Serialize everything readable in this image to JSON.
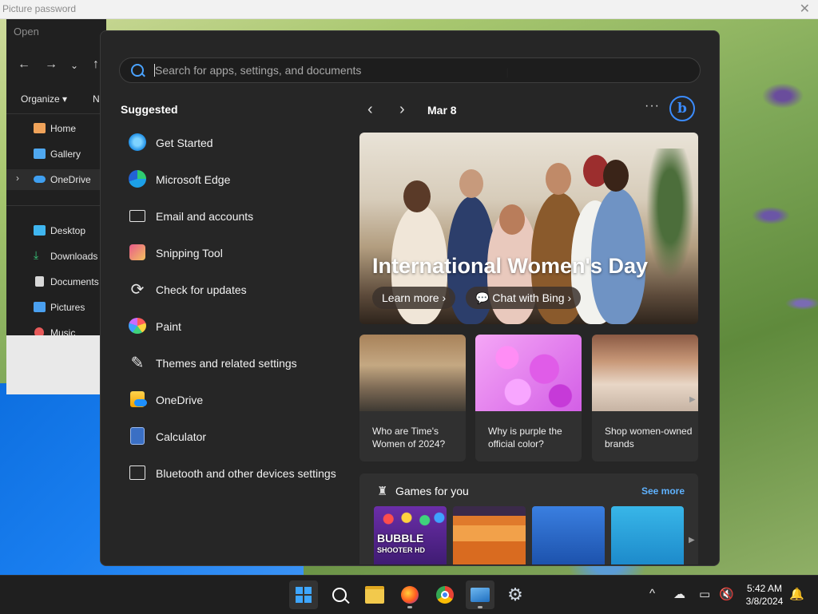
{
  "window": {
    "title": "Picture password",
    "close_glyph": "✕"
  },
  "explorer": {
    "title": "Open",
    "organize_label": "Organize",
    "new_label": "N",
    "nav_items": [
      {
        "label": "Home",
        "icon": "home-icon",
        "color": "#f0a35a"
      },
      {
        "label": "Gallery",
        "icon": "gallery-icon",
        "color": "#4fa8f0"
      },
      {
        "label": "OneDrive",
        "icon": "onedrive-icon",
        "color": "#3f9ff0"
      },
      {
        "label": "Desktop",
        "icon": "desktop-icon",
        "color": "#3fb6f0"
      },
      {
        "label": "Downloads",
        "icon": "downloads-icon",
        "color": "#38c77a"
      },
      {
        "label": "Documents",
        "icon": "documents-icon",
        "color": "#d8d8d8"
      },
      {
        "label": "Pictures",
        "icon": "pictures-icon",
        "color": "#4aa0f0"
      },
      {
        "label": "Music",
        "icon": "music-icon",
        "color": "#e85a5a"
      }
    ]
  },
  "start": {
    "search_placeholder": "Search for apps, settings, and documents",
    "suggested_title": "Suggested",
    "apps": [
      {
        "label": "Get Started",
        "icon": "get-started-icon"
      },
      {
        "label": "Microsoft Edge",
        "icon": "edge-icon"
      },
      {
        "label": "Email and accounts",
        "icon": "mail-icon"
      },
      {
        "label": "Snipping Tool",
        "icon": "snipping-tool-icon"
      },
      {
        "label": "Check for updates",
        "icon": "update-icon"
      },
      {
        "label": "Paint",
        "icon": "paint-icon"
      },
      {
        "label": "Themes and related settings",
        "icon": "brush-icon"
      },
      {
        "label": "OneDrive",
        "icon": "onedrive-icon"
      },
      {
        "label": "Calculator",
        "icon": "calculator-icon"
      },
      {
        "label": "Bluetooth and other devices settings",
        "icon": "devices-icon"
      }
    ],
    "widgets": {
      "date": "Mar 8",
      "more_glyph": "···",
      "bing_glyph": "b",
      "hero": {
        "title": "International Women's Day",
        "learn_more": "Learn more",
        "chat_bing": "Chat with Bing"
      },
      "cards": [
        {
          "caption": "Who are Time's Women of 2024?"
        },
        {
          "caption": "Why is purple the official color?"
        },
        {
          "caption": "Shop women-owned brands"
        }
      ],
      "games": {
        "title": "Games for you",
        "see_more": "See more",
        "tile1_text": "BUBBLE",
        "tile1_sub": "SHOOTER HD"
      }
    }
  },
  "taskbar": {
    "time": "5:42 AM",
    "date": "3/8/2024",
    "accent": "#3ea6ff"
  }
}
